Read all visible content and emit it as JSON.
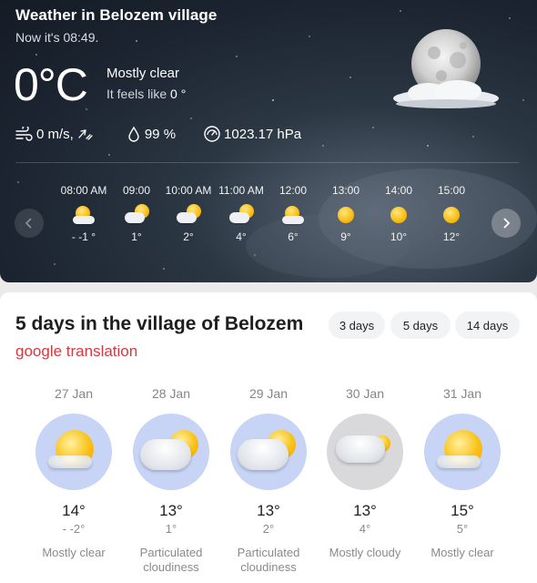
{
  "now": {
    "title": "Weather in Belozem village",
    "time_text": "Now it's 08:49.",
    "temp": "0°C",
    "condition": "Mostly clear",
    "feels_prefix": "It feels like",
    "feels_value": "0 °",
    "wind": "0 m/s,",
    "humidity": "99 %",
    "pressure": "1023.17 hPa",
    "icon": "moon-cloud-icon"
  },
  "hourly": [
    {
      "time": "08:00 AM",
      "temp": "- -1 °",
      "icon": "sun-cloud-icon"
    },
    {
      "time": "09:00",
      "temp": "1°",
      "icon": "cloud-sun-icon"
    },
    {
      "time": "10:00 AM",
      "temp": "2°",
      "icon": "cloud-sun-icon"
    },
    {
      "time": "11:00 AM",
      "temp": "4°",
      "icon": "cloud-sun-icon"
    },
    {
      "time": "12:00",
      "temp": "6°",
      "icon": "sun-cloud-icon"
    },
    {
      "time": "13:00",
      "temp": "9°",
      "icon": "sun-icon"
    },
    {
      "time": "14:00",
      "temp": "10°",
      "icon": "sun-icon"
    },
    {
      "time": "15:00",
      "temp": "12°",
      "icon": "sun-icon"
    }
  ],
  "forecast": {
    "title": "5 days in the village of Belozem",
    "translation_note": "google translation",
    "ranges": [
      "3 days",
      "5 days",
      "14 days"
    ],
    "days": [
      {
        "date": "27 Jan",
        "max": "14°",
        "min": "- -2°",
        "condition": "Mostly clear",
        "icon": "sun-cloud-icon"
      },
      {
        "date": "28 Jan",
        "max": "13°",
        "min": "1°",
        "condition": "Particulated cloudiness",
        "icon": "cloud-sun-icon"
      },
      {
        "date": "29 Jan",
        "max": "13°",
        "min": "2°",
        "condition": "Particulated cloudiness",
        "icon": "cloud-sun-icon"
      },
      {
        "date": "30 Jan",
        "max": "13°",
        "min": "4°",
        "condition": "Mostly cloudy",
        "icon": "cloudy-icon"
      },
      {
        "date": "31 Jan",
        "max": "15°",
        "min": "5°",
        "condition": "Mostly clear",
        "icon": "sun-cloud-icon"
      }
    ]
  },
  "colors": {
    "accent_red": "#d8383e",
    "day_circle": "#c7d4f6",
    "cloudy_circle": "#d9d9dc"
  }
}
